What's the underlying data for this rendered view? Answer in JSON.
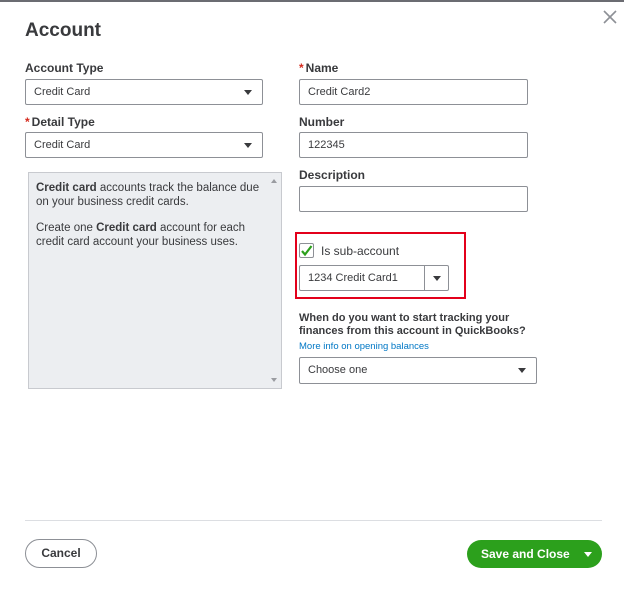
{
  "dialog": {
    "title": "Account"
  },
  "account_type": {
    "label": "Account Type",
    "value": "Credit Card"
  },
  "detail_type": {
    "label": "Detail Type",
    "value": "Credit Card"
  },
  "name": {
    "label": "Name",
    "value": "Credit Card2"
  },
  "number": {
    "label": "Number",
    "value": "122345"
  },
  "description": {
    "label": "Description",
    "value": ""
  },
  "required_marker": "*",
  "detail_description": {
    "p1": {
      "bold": "Credit card",
      "text": " accounts track the balance due on your business credit cards."
    },
    "p2": {
      "text1": "Create one ",
      "bold": "Credit card",
      "text2": " account for each credit card account your business uses."
    }
  },
  "sub_account": {
    "checked": true,
    "label": "Is sub-account",
    "parent_value": "1234 Credit Card1"
  },
  "tracking": {
    "question": "When do you want to start tracking your finances from this account in QuickBooks?",
    "link": "More info on opening balances",
    "select_value": "Choose one"
  },
  "footer": {
    "cancel_label": "Cancel",
    "save_label": "Save and Close"
  },
  "colors": {
    "primary_green": "#2ca01c",
    "link_blue": "#0077c5",
    "required_red": "#d52b1e",
    "highlight_red": "#e3001b"
  },
  "icons": {
    "close": "close-icon",
    "check": "checkmark-icon",
    "dropdown": "chevron-down-icon"
  }
}
